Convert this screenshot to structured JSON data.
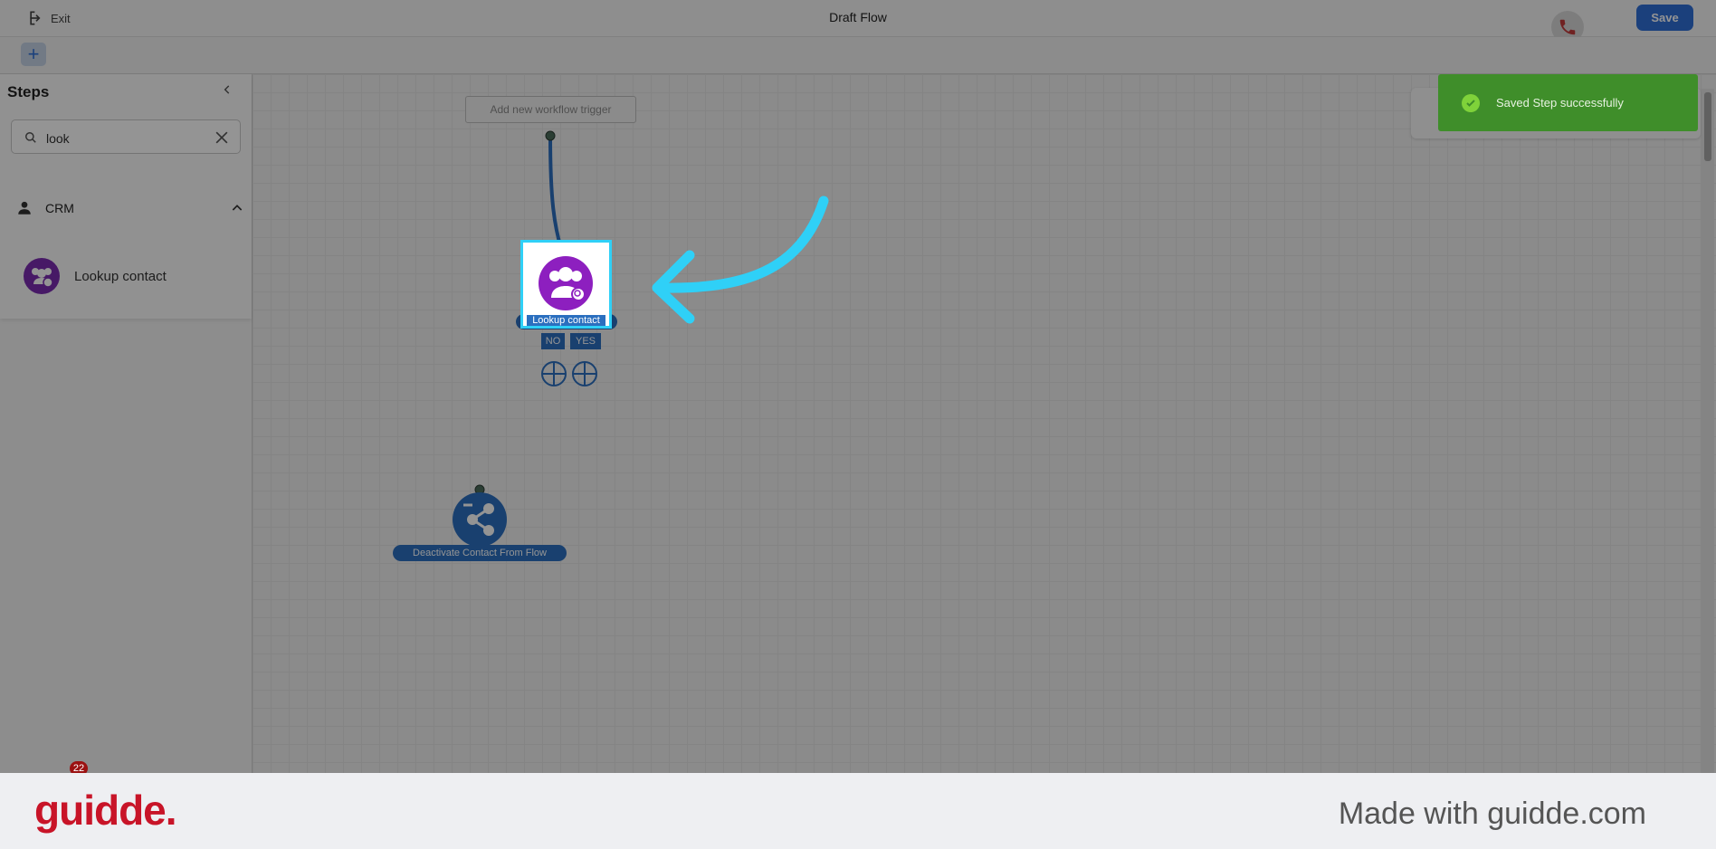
{
  "header": {
    "exit_label": "Exit",
    "title": "Draft Flow",
    "save_label": "Save"
  },
  "toolbar": {
    "add_label": "+"
  },
  "sidebar": {
    "title": "Steps",
    "search": {
      "value": "look"
    },
    "category": "CRM",
    "items": [
      {
        "label": "Lookup contact"
      }
    ],
    "notification_count": "22"
  },
  "canvas": {
    "trigger_button": "Add new workflow trigger",
    "nodes": [
      {
        "label": "Lookup contact",
        "branches": [
          "NO",
          "YES"
        ]
      },
      {
        "label": "Deactivate Contact From Flow"
      }
    ]
  },
  "toast": {
    "message": "Saved Step successfully"
  },
  "footer": {
    "brand": "guidde.",
    "tagline": "Made with guidde.com"
  },
  "colors": {
    "accent": "#2f6fd6",
    "node_blue": "#2b6fbf",
    "lookup_purple": "#8d1fbf",
    "toast_green": "#3f8e2a",
    "highlight": "#2fd0f7",
    "brand_red": "#c81428"
  }
}
